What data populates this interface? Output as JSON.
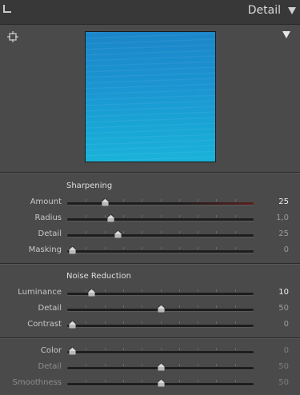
{
  "panel": {
    "title": "Detail"
  },
  "sharpening": {
    "title": "Sharpening",
    "rows": [
      {
        "label": "Amount",
        "value": "25",
        "fraction": 0.185
      },
      {
        "label": "Radius",
        "value": "1,0",
        "fraction": 0.215
      },
      {
        "label": "Detail",
        "value": "25",
        "fraction": 0.26
      },
      {
        "label": "Masking",
        "value": "0",
        "fraction": 0.0
      }
    ]
  },
  "noise_reduction": {
    "title": "Noise Reduction",
    "luminance_rows": [
      {
        "label": "Luminance",
        "value": "10",
        "fraction": 0.11
      },
      {
        "label": "Detail",
        "value": "50",
        "fraction": 0.5
      },
      {
        "label": "Contrast",
        "value": "0",
        "fraction": 0.0
      }
    ],
    "color_rows": [
      {
        "label": "Color",
        "value": "0",
        "fraction": 0.0
      },
      {
        "label": "Detail",
        "value": "50",
        "fraction": 0.5
      },
      {
        "label": "Smoothness",
        "value": "50",
        "fraction": 0.5
      }
    ]
  },
  "icons": {
    "collapse": "triangle-down-icon",
    "target": "crosshair-icon",
    "preview_toggle": "triangle-down-icon"
  },
  "colors": {
    "panel_bg": "#4a4a4a",
    "header_bg": "#383838",
    "water": "#1b96d2",
    "amount_track_accent": "#5a1f1f"
  }
}
